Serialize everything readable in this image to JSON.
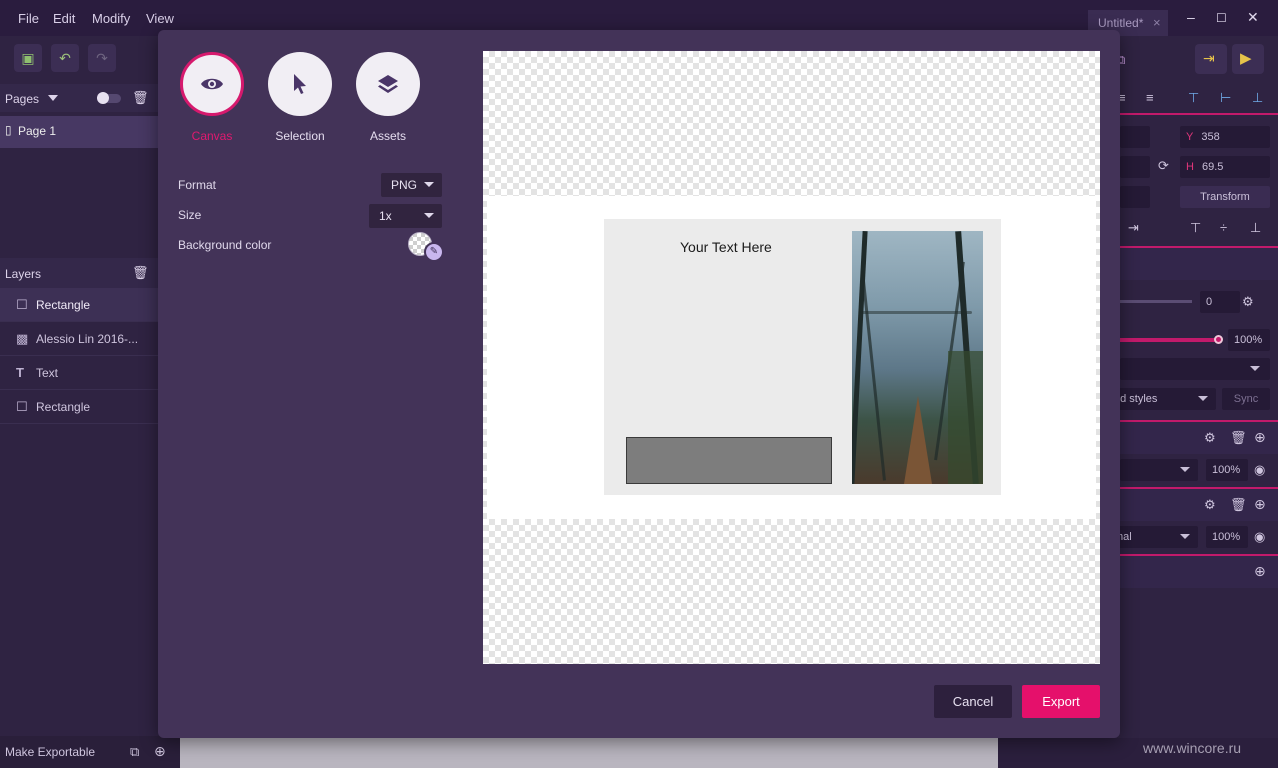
{
  "menu": {
    "file": "File",
    "edit": "Edit",
    "modify": "Modify",
    "view": "View"
  },
  "document_tab": {
    "title": "Untitled*",
    "close": "×"
  },
  "window_controls": {
    "minimize": "–",
    "maximize": "☐",
    "close": "✕"
  },
  "pages_panel": {
    "title": "Pages",
    "items": [
      "Page 1"
    ]
  },
  "layers_panel": {
    "title": "Layers",
    "items": [
      {
        "label": "Rectangle",
        "icon": "rectangle-icon",
        "selected": true
      },
      {
        "label": "Alessio Lin 2016-...",
        "icon": "image-icon",
        "selected": false
      },
      {
        "label": "Text",
        "icon": "text-icon",
        "selected": false
      },
      {
        "label": "Rectangle",
        "icon": "rectangle-icon",
        "selected": false
      }
    ]
  },
  "bottom_bar": {
    "label": "Make Exportable"
  },
  "inspector": {
    "y_label": "Y",
    "y_value": "358",
    "h_label": "H",
    "h_value": "69.5",
    "transform_label": "Transform",
    "blur_value": "0",
    "opacity_value": "100%",
    "styles_label": "ed styles",
    "sync_label": "Sync",
    "fill_opacity": "100%",
    "blend_label": "mal",
    "border_opacity": "100%"
  },
  "export_dialog": {
    "modes": [
      {
        "label": "Canvas",
        "icon": "eye-icon",
        "active": true
      },
      {
        "label": "Selection",
        "icon": "cursor-icon",
        "active": false
      },
      {
        "label": "Assets",
        "icon": "layers-icon",
        "active": false
      }
    ],
    "format_label": "Format",
    "format_value": "PNG",
    "size_label": "Size",
    "size_value": "1x",
    "background_label": "Background color",
    "preview_text": "Your Text Here",
    "cancel_label": "Cancel",
    "export_label": "Export"
  },
  "watermark": "www.wincore.ru",
  "colors": {
    "accent": "#e5106b",
    "modal_bg": "#433358",
    "app_bg": "#2b1f3d"
  }
}
